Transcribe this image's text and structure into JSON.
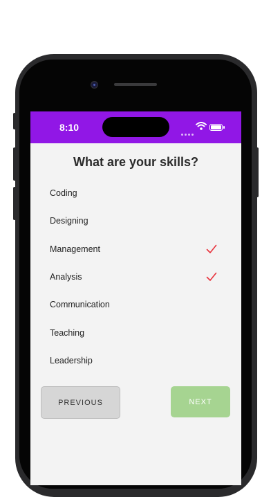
{
  "status_bar": {
    "time": "8:10",
    "icons": [
      "signal-dots-icon",
      "wifi-icon",
      "battery-icon"
    ]
  },
  "screen": {
    "title": "What are your skills?",
    "skills": [
      {
        "label": "Coding",
        "selected": false
      },
      {
        "label": "Designing",
        "selected": false
      },
      {
        "label": "Management",
        "selected": true
      },
      {
        "label": "Analysis",
        "selected": true
      },
      {
        "label": "Communication",
        "selected": false
      },
      {
        "label": "Teaching",
        "selected": false
      },
      {
        "label": "Leadership",
        "selected": false
      }
    ],
    "previous_label": "PREVIOUS",
    "next_label": "NEXT"
  },
  "colors": {
    "status_bar": "#9117e6",
    "check": "#e8323c",
    "next_button": "#a6d491",
    "previous_button": "#d6d6d6"
  }
}
